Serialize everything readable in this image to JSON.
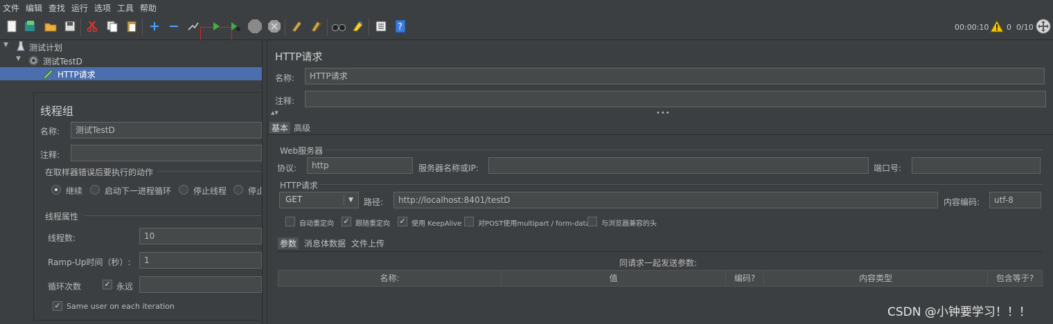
{
  "menu": [
    "文件",
    "编辑",
    "查找",
    "运行",
    "选项",
    "工具",
    "帮助"
  ],
  "toolbar": {
    "timer": "00:00:10",
    "warn_count": "0",
    "threads": "0/10",
    "icons": [
      "new-icon",
      "templates-icon",
      "open-icon",
      "save-icon",
      "cut-icon",
      "copy-icon",
      "paste-icon",
      "expand-icon",
      "collapse-icon",
      "toggle-icon",
      "start-icon",
      "start-no-pause-icon",
      "stop-icon",
      "shutdown-icon",
      "clear-icon",
      "clear-all-icon",
      "search-icon",
      "reset-search-icon",
      "function-helper-icon",
      "help-icon"
    ]
  },
  "tree": {
    "root": "测试计划",
    "thread_group": "测试TestD",
    "sampler": "HTTP请求"
  },
  "thread_group_panel": {
    "title": "线程组",
    "name_label": "名称:",
    "name_value": "测试TestD",
    "comment_label": "注释:",
    "error_action_title": "在取样器错误后要执行的动作",
    "error_actions": [
      "继续",
      "启动下一进程循环",
      "停止线程",
      "停止"
    ],
    "props_title": "线程属性",
    "thread_count_label": "线程数:",
    "thread_count": "10",
    "rampup_label": "Ramp-Up时间（秒）:",
    "rampup": "1",
    "loop_label": "循环次数",
    "forever_label": "永远",
    "same_user_label": "Same user on each iteration"
  },
  "http_panel": {
    "title": "HTTP请求",
    "name_label": "名称:",
    "name_value": "HTTP请求",
    "comment_label": "注释:",
    "tabs": [
      "基本",
      "高级"
    ],
    "web_server_title": "Web服务器",
    "protocol_label": "协议:",
    "protocol": "http",
    "server_label": "服务器名称或IP:",
    "port_label": "端口号:",
    "http_req_title": "HTTP请求",
    "method": "GET",
    "path_label": "路径:",
    "path": "http://localhost:8401/testD",
    "encoding_label": "内容编码:",
    "encoding": "utf-8",
    "options": [
      {
        "label": "自动重定向",
        "checked": false
      },
      {
        "label": "跟随重定向",
        "checked": true
      },
      {
        "label": "使用 KeepAlive",
        "checked": true
      },
      {
        "label": "对POST使用multipart / form-data",
        "checked": false
      },
      {
        "label": "与浏览器兼容的头",
        "checked": false
      }
    ],
    "subtabs": [
      "参数",
      "消息体数据",
      "文件上传"
    ],
    "params_caption": "同请求一起发送参数:",
    "columns": [
      "名称:",
      "值",
      "编码?",
      "内容类型",
      "包含等于?"
    ]
  },
  "watermark": "CSDN @小钟要学习！！！",
  "colors": {
    "selection": "#4b6eaf",
    "background": "#3c3f41",
    "start_green": "#3fae3f",
    "highlight_box": "#dd2222"
  }
}
